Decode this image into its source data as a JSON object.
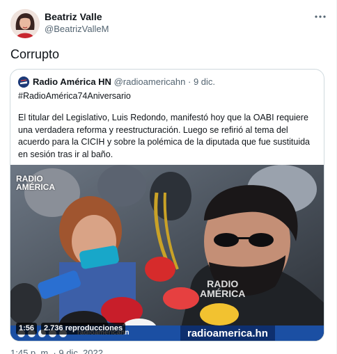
{
  "author": {
    "name": "Beatriz Valle",
    "handle": "@BeatrizValleM",
    "avatar_icon": "profile-photo"
  },
  "tweet": {
    "text": "Corrupto",
    "timestamp": "1:45 p. m. · 9 dic. 2022"
  },
  "quoted_tweet": {
    "name": "Radio América HN",
    "handle": "@radioamericahn",
    "date": "· 9 dic.",
    "hashtag": "#RadioAmérica74Aniversario",
    "body": "El titular del Legislativo, Luis Redondo, manifestó hoy que la OABI requiere una verdadera reforma y reestructuración. Luego se refirió al tema del acuerdo para la CICIH y sobre la polémica de la diputada que fue sustituida en sesión tras ir al baño.",
    "video": {
      "duration": "1:56",
      "views": "2.736 reproducciones",
      "watermark_top": "RADIO\nAMÉRICA",
      "watermark_mid": "RADIO\nAMÉRICA",
      "banner_handle": "radioamericahn",
      "banner_site": "radioamerica.hn"
    }
  },
  "colors": {
    "text_primary": "#0f1419",
    "text_secondary": "#536471",
    "border": "#cfd9de",
    "banner_blue": "#1b4fa3"
  }
}
